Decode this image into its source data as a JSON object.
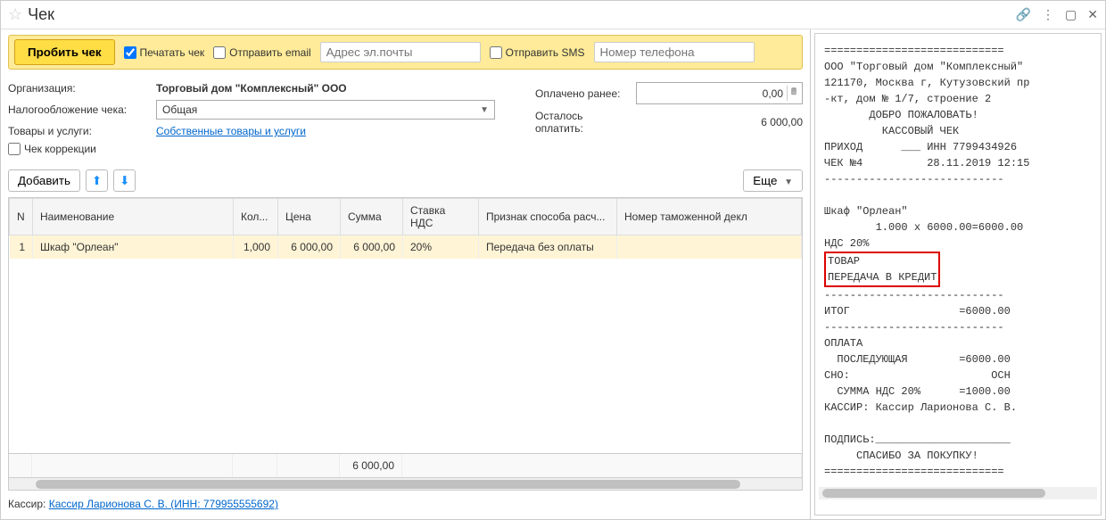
{
  "title": "Чек",
  "toolbar": {
    "punch_button": "Пробить чек",
    "print_check": "Печатать чек",
    "send_email": "Отправить email",
    "email_placeholder": "Адрес эл.почты",
    "send_sms": "Отправить SMS",
    "phone_placeholder": "Номер телефона"
  },
  "form": {
    "org_label": "Организация:",
    "org_value": "Торговый дом \"Комплексный\" ООО",
    "tax_label": "Налогообложение чека:",
    "tax_value": "Общая",
    "goods_label": "Товары и услуги:",
    "goods_link": "Собственные товары и услуги",
    "correction_check": "Чек коррекции",
    "paid_label": "Оплачено ранее:",
    "paid_value": "0,00",
    "remain_label": "Осталось оплатить:",
    "remain_value": "6 000,00"
  },
  "table_toolbar": {
    "add_button": "Добавить",
    "more_button": "Еще"
  },
  "table": {
    "headers": {
      "n": "N",
      "name": "Наименование",
      "qty": "Кол...",
      "price": "Цена",
      "sum": "Сумма",
      "vat": "Ставка НДС",
      "method": "Признак способа расч...",
      "decl": "Номер таможенной декл"
    },
    "rows": [
      {
        "n": "1",
        "name": "Шкаф \"Орлеан\"",
        "qty": "1,000",
        "price": "6 000,00",
        "sum": "6 000,00",
        "vat": "20%",
        "method": "Передача без оплаты",
        "decl": ""
      }
    ],
    "footer_sum": "6 000,00"
  },
  "footer": {
    "cashier_label": "Кассир:",
    "cashier_link": "Кассир Ларионова С. В. (ИНН: 779955555692)"
  },
  "receipt": {
    "line_top": "============================",
    "company": "ООО \"Торговый дом \"Комплексный\"",
    "addr1": "121170, Москва г, Кутузовский пр",
    "addr2": "-кт, дом № 1/7, строение 2",
    "welcome": "       ДОБРО ПОЖАЛОВАТЬ!",
    "kass": "         КАССОВЫЙ ЧЕК",
    "inn": "ПРИХОД      ___ ИНН 7799434926",
    "chnum": "ЧЕК №4          28.11.2019 12:15",
    "dashes": "----------------------------",
    "item": "Шкаф \"Орлеан\"",
    "itemline": "        1.000 x 6000.00=6000.00",
    "nds": "НДС 20%",
    "tovar": "ТОВАР",
    "credit": "ПЕРЕДАЧА В КРЕДИТ",
    "itog": "ИТОГ                 =6000.00",
    "oplata": "ОПЛАТА",
    "posled": "  ПОСЛЕДУЮЩАЯ        =6000.00",
    "sno": "СНО:                      ОСН",
    "summands": "  СУММА НДС 20%      =1000.00",
    "kassir": "КАССИР: Кассир Ларионова С. В.",
    "podpis": "ПОДПИСЬ:_____________________",
    "spasibo": "     СПАСИБО ЗА ПОКУПКУ!",
    "bottom": "============================"
  }
}
